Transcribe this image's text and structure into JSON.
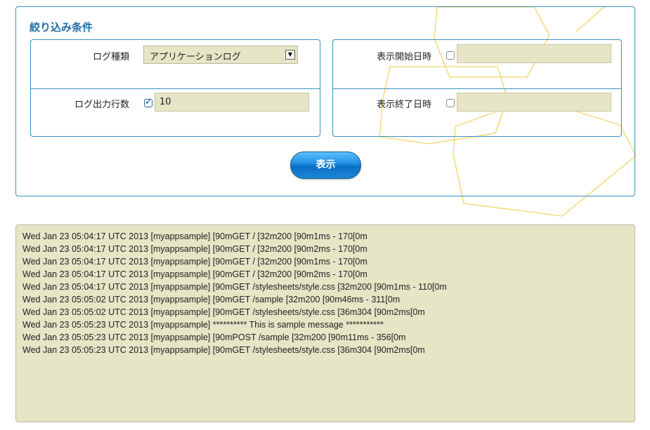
{
  "filter": {
    "title": "絞り込み条件",
    "log_type": {
      "label": "ログ種類",
      "selected": "アプリケーションログ"
    },
    "log_lines": {
      "label": "ログ出力行数",
      "checked": true,
      "value": "10"
    },
    "start_datetime": {
      "label": "表示開始日時",
      "checked": false,
      "value": ""
    },
    "end_datetime": {
      "label": "表示終了日時",
      "checked": false,
      "value": ""
    },
    "show_button_label": "表示"
  },
  "colors": {
    "panel_border": "#3a8fc1",
    "title": "#1f6fa8",
    "field_bg": "#e6e5c6",
    "decoration": "#f5d469"
  },
  "log": {
    "lines": [
      "Wed Jan 23 05:04:17 UTC 2013 [myappsample] [90mGET / [32m200 [90m1ms - 170[0m",
      "Wed Jan 23 05:04:17 UTC 2013 [myappsample] [90mGET / [32m200 [90m2ms - 170[0m",
      "Wed Jan 23 05:04:17 UTC 2013 [myappsample] [90mGET / [32m200 [90m1ms - 170[0m",
      "Wed Jan 23 05:04:17 UTC 2013 [myappsample] [90mGET / [32m200 [90m2ms - 170[0m",
      "Wed Jan 23 05:04:17 UTC 2013 [myappsample] [90mGET /stylesheets/style.css [32m200 [90m1ms - 110[0m",
      "Wed Jan 23 05:05:02 UTC 2013 [myappsample] [90mGET /sample [32m200 [90m46ms - 311[0m",
      "Wed Jan 23 05:05:02 UTC 2013 [myappsample] [90mGET /stylesheets/style.css [36m304 [90m2ms[0m",
      "Wed Jan 23 05:05:23 UTC 2013 [myappsample] ********** This is sample message ***********",
      "Wed Jan 23 05:05:23 UTC 2013 [myappsample] [90mPOST /sample [32m200 [90m11ms - 356[0m",
      "Wed Jan 23 05:05:23 UTC 2013 [myappsample] [90mGET /stylesheets/style.css [36m304 [90m2ms[0m"
    ]
  }
}
